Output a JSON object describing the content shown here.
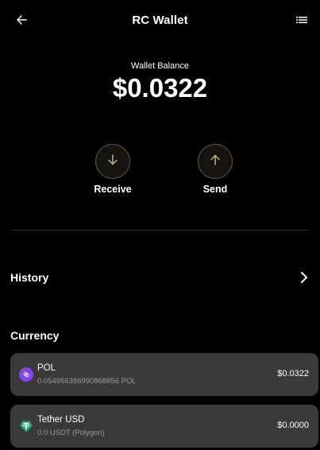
{
  "header": {
    "title": "RC Wallet",
    "back_icon": "arrow-left-icon",
    "menu_icon": "list-icon"
  },
  "balance": {
    "label": "Wallet Balance",
    "value": "$0.0322"
  },
  "actions": {
    "receive_label": "Receive",
    "send_label": "Send",
    "receive_icon": "arrow-down-icon",
    "send_icon": "arrow-up-icon"
  },
  "history": {
    "label": "History",
    "icon": "chevron-right-icon"
  },
  "currency": {
    "label": "Currency",
    "items": [
      {
        "name": "POL",
        "amount": "0.054956386990868856 POL",
        "value": "$0.0322",
        "icon": "polygon-icon",
        "icon_color": "#8247e5"
      },
      {
        "name": "Tether USD",
        "amount": "0.0 USDT (Polygon)",
        "value": "$0.0000",
        "icon": "tether-icon",
        "icon_color": "#26a17b"
      }
    ]
  },
  "colors": {
    "background": "#000000",
    "card": "#3a3a3a",
    "action_ring": "#6b5a40",
    "action_arrow": "#c9b28a"
  }
}
